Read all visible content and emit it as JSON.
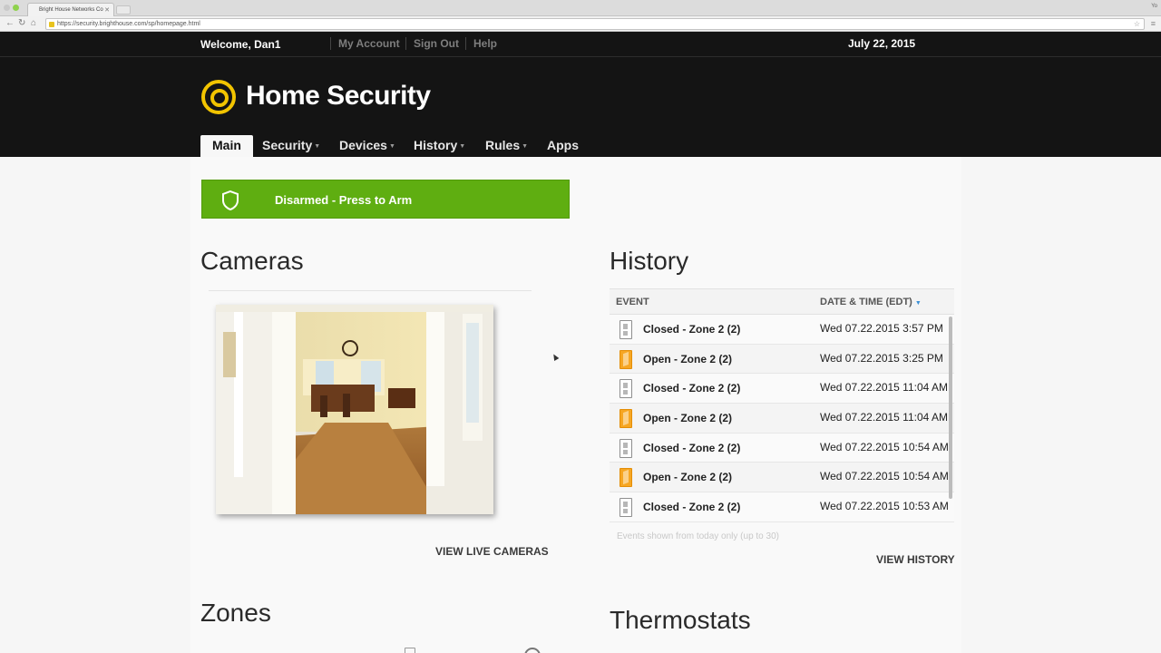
{
  "browser": {
    "tab_title": "Bright House Networks Co",
    "url": "https://security.brighthouse.com/sp/homepage.html",
    "user_label": "Yo"
  },
  "header": {
    "welcome": "Welcome, Dan1",
    "links": [
      "My Account",
      "Sign Out",
      "Help"
    ],
    "date": "July 22, 2015",
    "brand": "Home Security",
    "nav": [
      "Main",
      "Security",
      "Devices",
      "History",
      "Rules",
      "Apps"
    ],
    "active_nav": "Main"
  },
  "arm_button": {
    "label": "Disarmed - Press to Arm",
    "color": "#5fae11"
  },
  "cameras": {
    "title": "Cameras",
    "view_link": "VIEW LIVE CAMERAS"
  },
  "history": {
    "title": "History",
    "columns": [
      "EVENT",
      "DATE & TIME (EDT)"
    ],
    "rows": [
      {
        "event": "Closed - Zone 2 (2)",
        "time": "Wed 07.22.2015 3:57 PM",
        "icon": "door-closed-icon"
      },
      {
        "event": "Open - Zone 2 (2)",
        "time": "Wed 07.22.2015 3:25 PM",
        "icon": "door-open-icon"
      },
      {
        "event": "Closed - Zone 2 (2)",
        "time": "Wed 07.22.2015 11:04 AM",
        "icon": "door-closed-icon"
      },
      {
        "event": "Open - Zone 2 (2)",
        "time": "Wed 07.22.2015 11:04 AM",
        "icon": "door-open-icon"
      },
      {
        "event": "Closed - Zone 2 (2)",
        "time": "Wed 07.22.2015 10:54 AM",
        "icon": "door-closed-icon"
      },
      {
        "event": "Open - Zone 2 (2)",
        "time": "Wed 07.22.2015 10:54 AM",
        "icon": "door-open-icon"
      },
      {
        "event": "Closed - Zone 2 (2)",
        "time": "Wed 07.22.2015 10:53 AM",
        "icon": "door-closed-icon"
      }
    ],
    "footnote": "Events shown from today only (up to 30)",
    "view_link": "VIEW HISTORY"
  },
  "zones": {
    "title": "Zones"
  },
  "thermostats": {
    "title": "Thermostats"
  }
}
